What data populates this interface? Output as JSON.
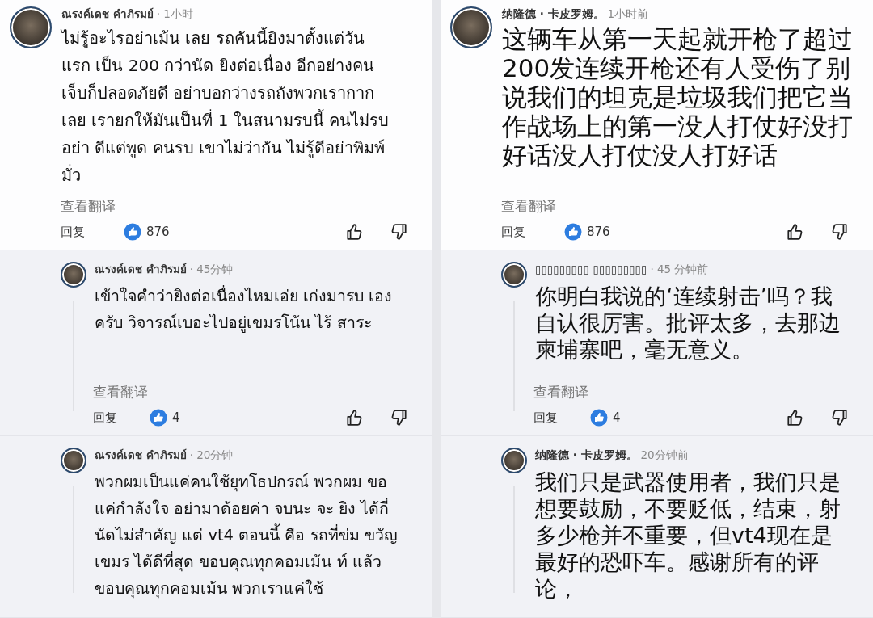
{
  "columns": [
    {
      "kind": "original",
      "comments": [
        {
          "kind": "top",
          "author": "ณรงค์เดช คำภิรมย์",
          "time": "· 1小时",
          "body": "ไม่รู้อะไรอย่าเม้น เลย รถคันนี้ยิงมาตั้งแต่วัน แรก เป็น 200 กว่านัด ยิงต่อเนื่อง อีกอย่างคน เจ็บก็ปลอดภัยดี อย่าบอกว่างรถถังพวกเรากาก เลย เรายกให้มันเป็นที่ 1 ในสนามรบนี้ คนไม่รบ อย่า ดีแต่พูด คนรบ เขาไม่ว่ากัน ไม่รู้ดีอย่าพิมพ์ มั่ว",
          "translate": "查看翻译",
          "reply": "回复",
          "reactions": "876"
        },
        {
          "kind": "reply",
          "author": "ณรงค์เดช คำภิรมย์",
          "time": "· 45分钟",
          "body": "เข้าใจคำว่ายิงต่อเนื่องไหมเอ่ย เก่งมารบ เองครับ วิจารณ์เบอะไปอยู่เขมรโน้น ไร้ สาระ",
          "translate": "查看翻译",
          "reply": "回复",
          "reactions": "4"
        },
        {
          "kind": "reply",
          "author": "ณรงค์เดช คำภิรมย์",
          "time": "· 20分钟",
          "body": "พวกผมเป็นแค่คนใช้ยุทโธปกรณ์ พวกผม ขอแค่กำลังใจ อย่ามาด้อยค่า จบนะ จะ ยิง ได้กี่นัดไม่สำคัญ แต่ vt4 ตอนนี้ คือ รถที่ข่ม ขวัญ เขมร ได้ดีที่สุด ขอบคุณทุกคอมเม้น ท์ แล้ว ขอบคุณทุกคอมเม้น พวกเราแค่ใช้"
        }
      ]
    },
    {
      "kind": "translation",
      "comments": [
        {
          "kind": "top",
          "author": "纳隆德 · 卡皮罗姆。",
          "time": "1小时前",
          "body": "这辆车从第一天起就开枪了超过200发连续开枪还有人受伤了别说我们的坦克是垃圾我们把它当作战场上的第一没人打仗好没打好话没人打仗没人打好话",
          "translate": "查看翻译",
          "reply": "回复",
          "reactions": "876"
        },
        {
          "kind": "reply",
          "author": "▯▯▯▯▯▯▯▯▯ ▯▯▯▯▯▯▯▯▯",
          "time": "· 45 分钟前",
          "body": "你明白我说的‘连续射击’吗？我自认很厉害。批评太多，去那边柬埔寨吧，毫无意义。",
          "translate": "查看翻译",
          "reply": "回复",
          "reactions": "4"
        },
        {
          "kind": "reply",
          "author": "纳隆德 · 卡皮罗姆。",
          "time": "20分钟前",
          "body": "我们只是武器使用者，我们只是想要鼓励，不要贬低，结束，射多少枪并不重要，但vt4现在是最好的恐吓车。感谢所有的评论，"
        }
      ]
    }
  ]
}
